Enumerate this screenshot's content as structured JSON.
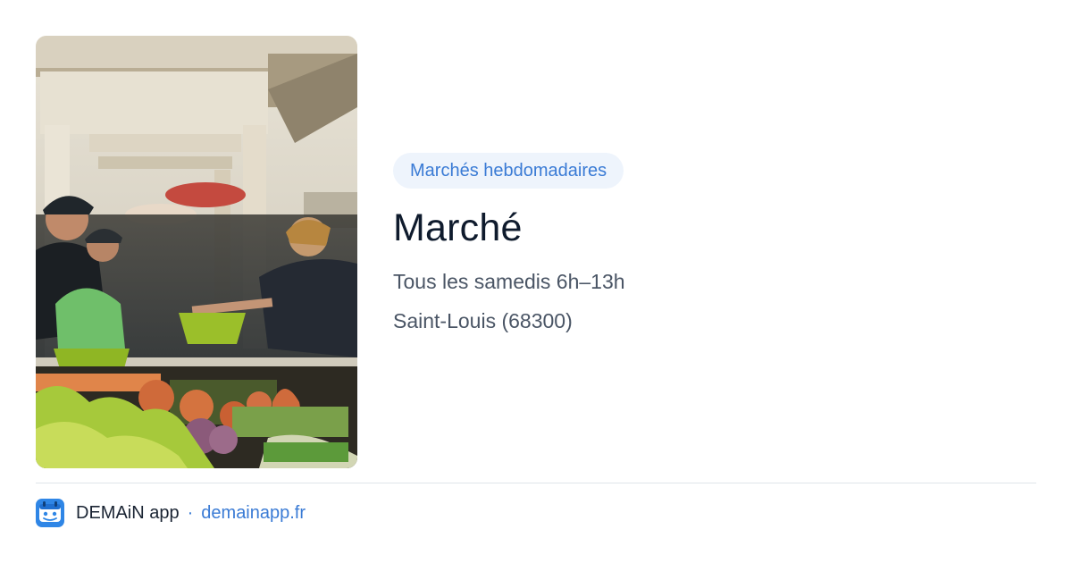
{
  "event": {
    "category": "Marchés hebdomadaires",
    "title": "Marché",
    "schedule": "Tous les samedis 6h–13h",
    "location": "Saint-Louis (68300)"
  },
  "photo": {
    "subject": "market-stall-photo"
  },
  "footer": {
    "app_name": "DEMAiN app",
    "separator": "·",
    "site": "demainapp.fr"
  },
  "colors": {
    "accent": "#3a7bd5",
    "badge_bg": "#eef4fc",
    "title": "#0f1b2d",
    "body_text": "#4a5565",
    "divider": "#dfe5ea"
  }
}
